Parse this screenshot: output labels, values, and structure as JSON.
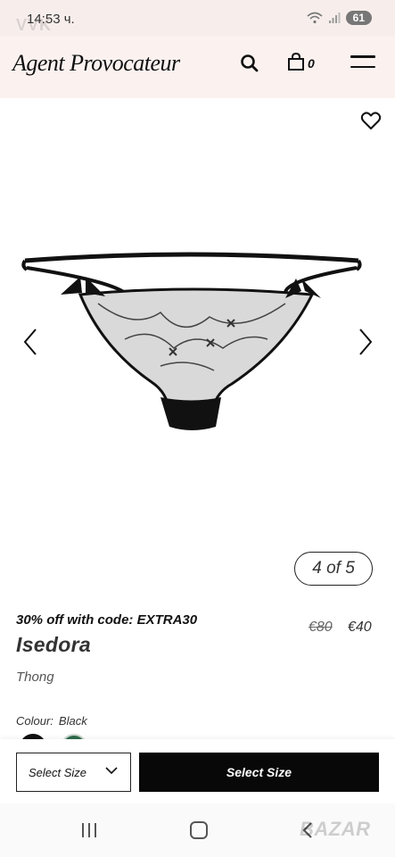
{
  "status_bar": {
    "time": "14:53 ч.",
    "battery": "61",
    "watermark": "VVK"
  },
  "header": {
    "brand": "Agent Provocateur",
    "bag_count": "0"
  },
  "gallery": {
    "counter": "4 of 5"
  },
  "product": {
    "promo": "30% off with code: EXTRA30",
    "old_price": "€80",
    "new_price": "€40",
    "name": "Isedora",
    "type": "Thong",
    "colour_label": "Colour:",
    "colour_value": "Black",
    "swatches": [
      "#111111",
      "#2f6b4b"
    ]
  },
  "sticky": {
    "size_placeholder": "Select Size",
    "cta_label": "Select Size"
  },
  "nav": {
    "watermark": "BAZAR"
  },
  "colors": {
    "header_bg": "#fbf2f0",
    "cta_bg": "#080808"
  }
}
